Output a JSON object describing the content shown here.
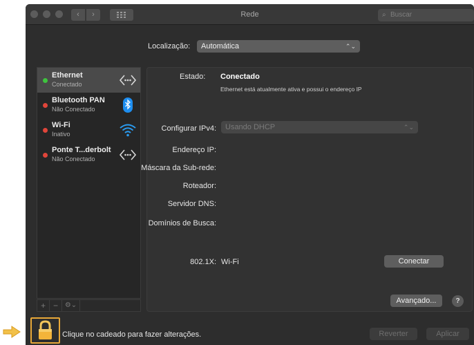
{
  "window": {
    "title": "Rede",
    "search_placeholder": "Buscar"
  },
  "location": {
    "label": "Localização:",
    "value": "Automática"
  },
  "services": [
    {
      "name": "Ethernet",
      "status": "Conectado",
      "status_color": "#3ec43e",
      "icon": "ethernet-arrows-icon",
      "selected": true
    },
    {
      "name": "Bluetooth PAN",
      "status": "Não Conectado",
      "status_color": "#e0453a",
      "icon": "bluetooth-icon",
      "selected": false
    },
    {
      "name": "Wi-Fi",
      "status": "Inativo",
      "status_color": "#e0453a",
      "icon": "wifi-icon",
      "selected": false
    },
    {
      "name": "Ponte T...derbolt",
      "status": "Não Conectado",
      "status_color": "#e0453a",
      "icon": "thunderbolt-bridge-arrows-icon",
      "selected": false
    }
  ],
  "sidebar_tools": {
    "add": "+",
    "remove": "−",
    "action": "⚙⌄"
  },
  "detail": {
    "state_label": "Estado:",
    "state_value": "Conectado",
    "state_description": "Ethernet está atualmente ativa e possui o endereço IP",
    "ipv4_label": "Configurar IPv4:",
    "ipv4_value": "Usando DHCP",
    "ip_label": "Endereço IP:",
    "subnet_label": "Máscara da Sub-rede:",
    "router_label": "Roteador:",
    "dns_label": "Servidor DNS:",
    "search_domains_label": "Domínios de Busca:",
    "dot1x_label": "802.1X:",
    "dot1x_value": "Wi-Fi",
    "connect_button": "Conectar",
    "advanced_button": "Avançado...",
    "help_button": "?"
  },
  "footer": {
    "lock_text": "Clique no cadeado para fazer alterações.",
    "revert_button": "Reverter",
    "apply_button": "Aplicar"
  },
  "colors": {
    "accent_lock": "#e8a838",
    "bluetooth_blue": "#1e8ef0",
    "wifi_blue": "#2a9bf0"
  }
}
